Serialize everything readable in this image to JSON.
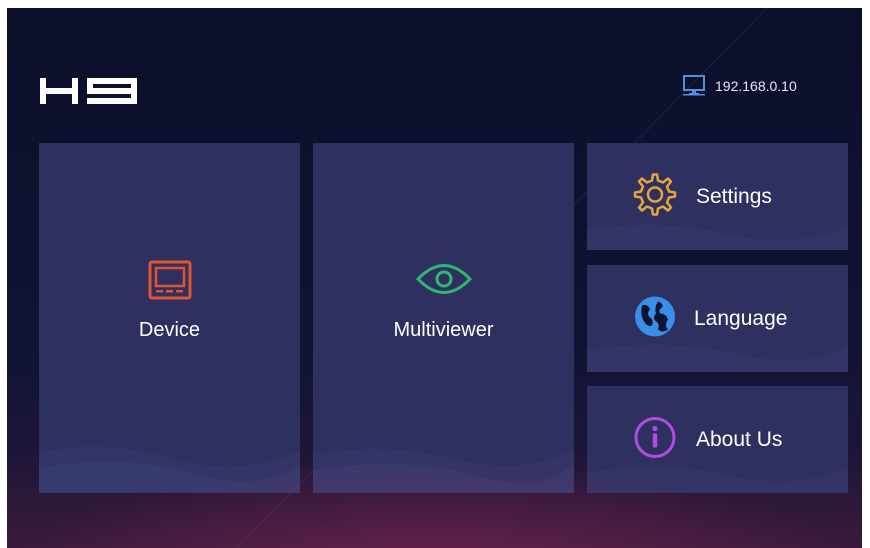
{
  "header": {
    "logo_text": "H9",
    "network_icon": "monitor-network-icon",
    "ip_address": "192.168.0.10"
  },
  "tiles": [
    {
      "label": "Device",
      "icon": "device-monitor-icon",
      "icon_color": "#e0552e"
    },
    {
      "label": "Multiviewer",
      "icon": "eye-icon",
      "icon_color": "#2fb872"
    },
    {
      "label": "Settings",
      "icon": "gear-icon",
      "icon_color": "#e8a43a"
    },
    {
      "label": "Language",
      "icon": "globe-icon",
      "icon_color": "#3a8ee8"
    },
    {
      "label": "About Us",
      "icon": "info-icon",
      "icon_color": "#b04ce6"
    }
  ],
  "colors": {
    "background": "#0f1433",
    "tile": "#2e3060",
    "text": "#ffffff"
  }
}
